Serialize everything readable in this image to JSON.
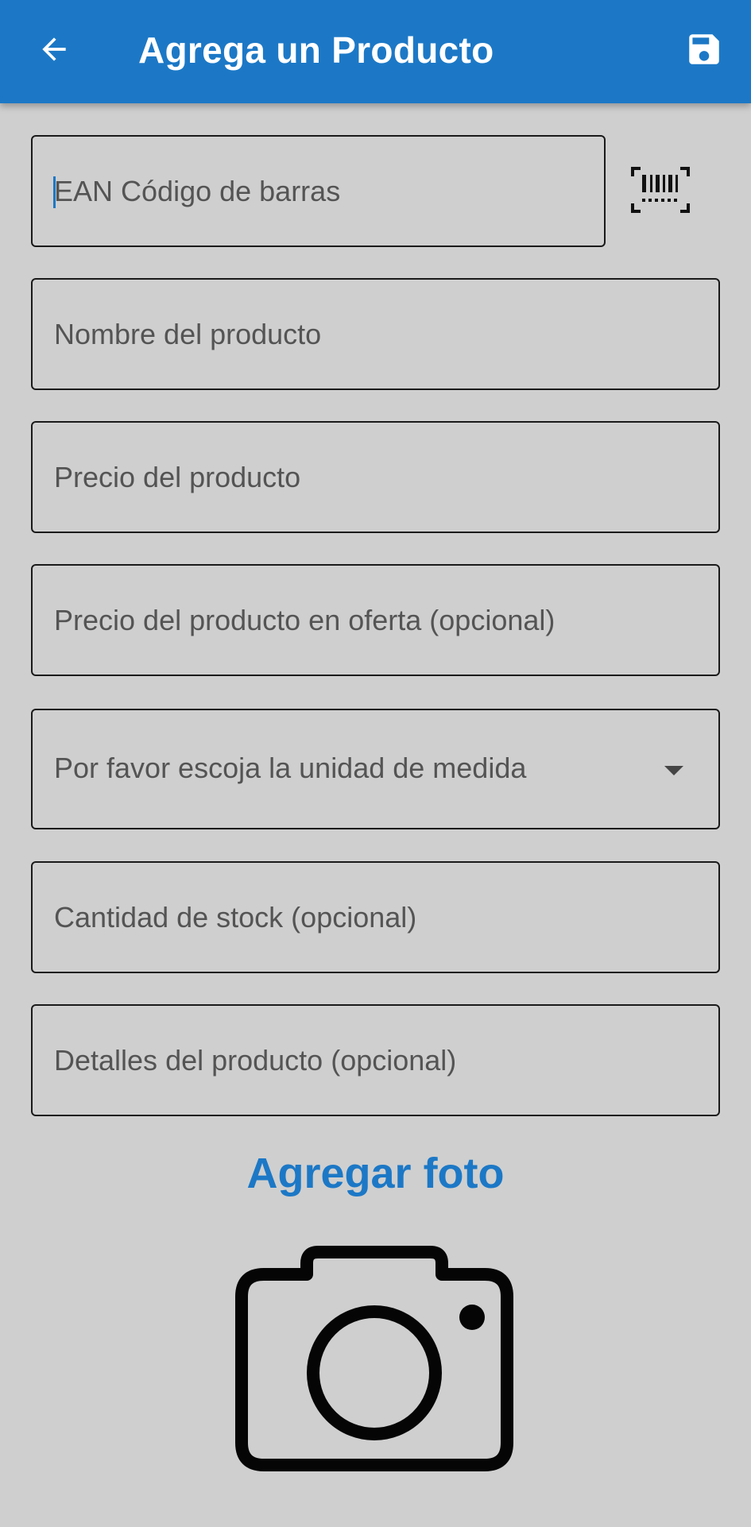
{
  "appbar": {
    "title": "Agrega un Producto",
    "back_icon": "arrow-left-icon",
    "save_icon": "floppy-disk-icon",
    "background_color": "#1c78c6"
  },
  "form": {
    "ean_placeholder": "EAN Código de barras",
    "name_placeholder": "Nombre del producto",
    "price_placeholder": "Precio del producto",
    "offer_price_placeholder": "Precio del producto en oferta (opcional)",
    "unit_select_label": "Por favor escoja la unidad de medida",
    "stock_placeholder": "Cantidad de stock (opcional)",
    "details_placeholder": "Detalles del producto (opcional)",
    "barcode_icon": "barcode-scan-icon"
  },
  "photo": {
    "add_label": "Agregar foto",
    "camera_icon": "camera-icon",
    "accent_color": "#1c78c6"
  }
}
